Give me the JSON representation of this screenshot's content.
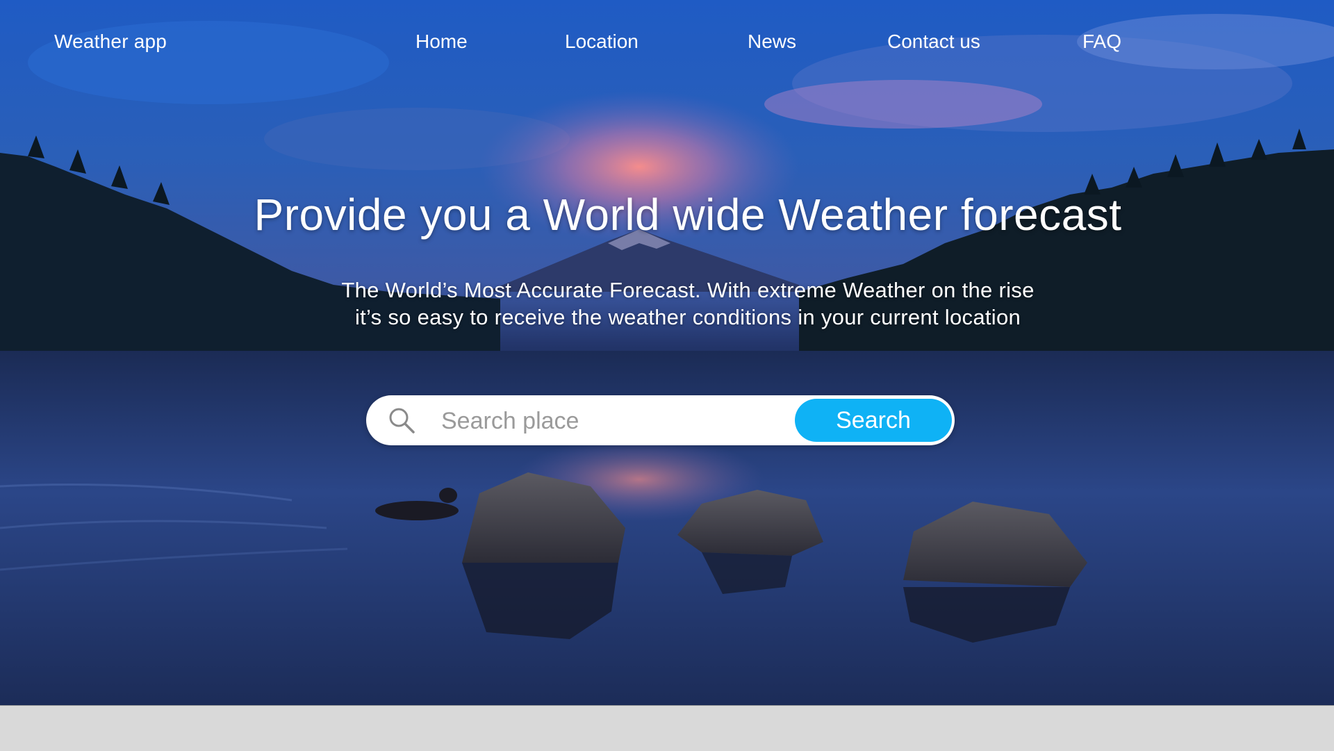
{
  "nav": {
    "brand": "Weather app",
    "links": [
      "Home",
      "Location",
      "News",
      "Contact us",
      "FAQ"
    ]
  },
  "hero": {
    "headline": "Provide you a World wide Weather forecast",
    "subline_1": "The World’s Most Accurate Forecast. With extreme Weather on the rise",
    "subline_2": "it’s so easy to receive the weather conditions in your current location"
  },
  "search": {
    "placeholder": "Search place",
    "value": "",
    "button_label": "Search",
    "icon": "search-icon"
  },
  "colors": {
    "accent": "#0fb2f5",
    "footer_band": "#d9d9d9",
    "text": "#ffffff"
  }
}
